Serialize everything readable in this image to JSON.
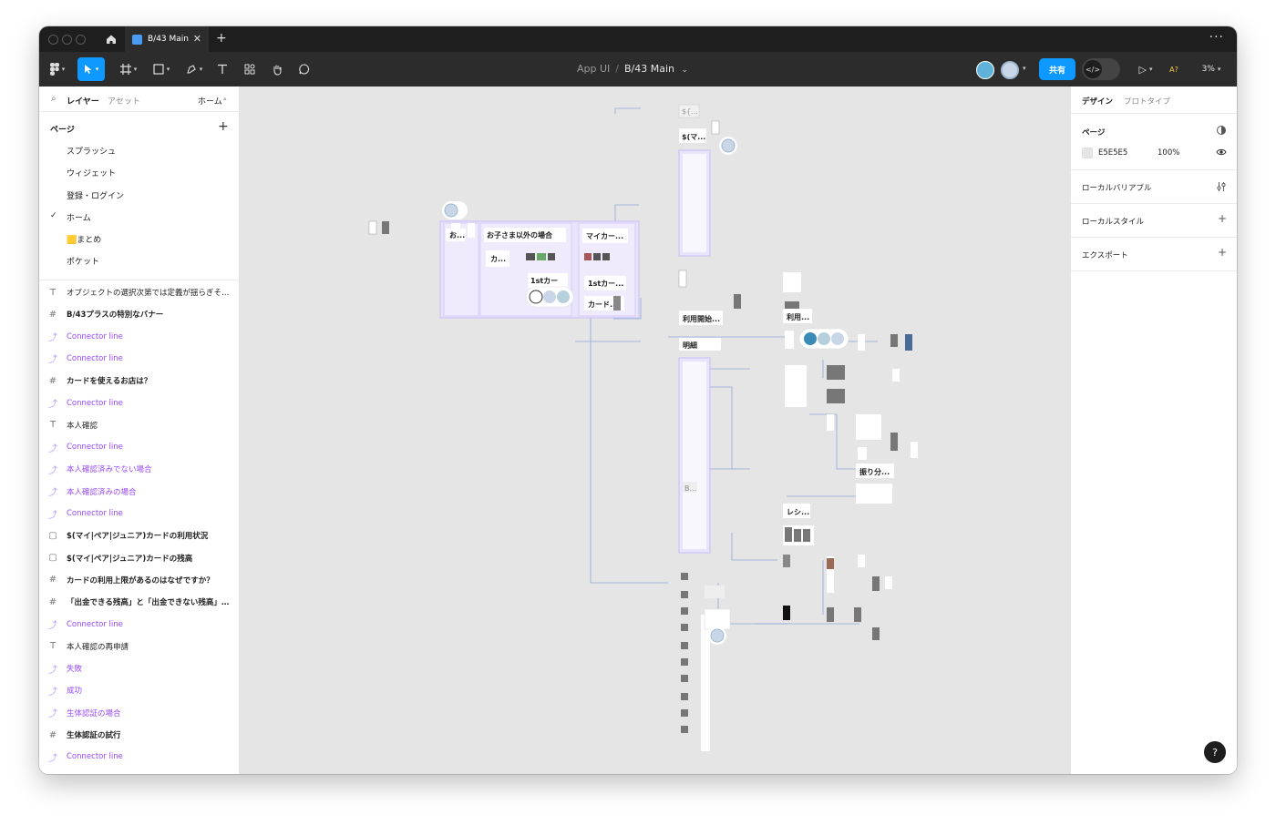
{
  "titlebar": {
    "tab_title": "B/43 Main",
    "close_glyph": "✕",
    "add_glyph": "+",
    "more_glyph": "···"
  },
  "toolbar": {
    "breadcrumb_project": "App UI",
    "breadcrumb_separator": "/",
    "breadcrumb_file": "B/43 Main",
    "breadcrumb_chevron": "⌄",
    "share_label": "共有",
    "dev_mode_glyph": "</>",
    "play_glyph": "▷",
    "ai_badge": "A?",
    "zoom": "3%"
  },
  "left_panel": {
    "tab_layers": "レイヤー",
    "tab_assets": "アセット",
    "current_page_label": "ホーム",
    "pages_heading": "ページ",
    "pages_add": "+",
    "pages": [
      {
        "label": "スプラッシュ",
        "selected": false
      },
      {
        "label": "ウィジェット",
        "selected": false
      },
      {
        "label": "登録・ログイン",
        "selected": false
      },
      {
        "label": "ホーム",
        "selected": true
      },
      {
        "label": "🟨まとめ",
        "selected": false
      },
      {
        "label": "ポケット",
        "selected": false
      }
    ],
    "check_glyph": "✓",
    "layers": [
      {
        "type": "text",
        "label": "オブジェクトの選択次第では定義が揺らぎそう..."
      },
      {
        "type": "frame",
        "label": "B/43プラスの特別なバナー"
      },
      {
        "type": "component",
        "label": "Connector line"
      },
      {
        "type": "component",
        "label": "Connector line"
      },
      {
        "type": "frame",
        "label": "カードを使えるお店は？"
      },
      {
        "type": "component",
        "label": "Connector line"
      },
      {
        "type": "text",
        "label": "本人確認"
      },
      {
        "type": "component",
        "label": "Connector line"
      },
      {
        "type": "component",
        "label": "本人確認済みでない場合"
      },
      {
        "type": "component",
        "label": "本人確認済みの場合"
      },
      {
        "type": "component",
        "label": "Connector line"
      },
      {
        "type": "section",
        "label": "$(マイ|ペア|ジュニア)カードの利用状況"
      },
      {
        "type": "section",
        "label": "$(マイ|ペア|ジュニア)カードの残高"
      },
      {
        "type": "frame",
        "label": "カードの利用上限があるのはなぜですか？"
      },
      {
        "type": "frame",
        "label": "「出金できる残高」と「出金できない残高」の..."
      },
      {
        "type": "component",
        "label": "Connector line"
      },
      {
        "type": "text",
        "label": "本人確認の再申請"
      },
      {
        "type": "component",
        "label": "失敗"
      },
      {
        "type": "component",
        "label": "成功"
      },
      {
        "type": "component",
        "label": "生体認証の場合"
      },
      {
        "type": "frame",
        "label": "生体認証の試行"
      },
      {
        "type": "component",
        "label": "Connector line"
      }
    ]
  },
  "canvas": {
    "labels": {
      "l1": "${...",
      "l2": "$(マ...",
      "l3": "お...",
      "l4": "お子さま以外の場合",
      "l5": "マイカー...",
      "l6": "カ...",
      "l7": "1stカー",
      "l8": "1stカー...",
      "l9": "カード...",
      "l10": "利用開始...",
      "l11": "明細",
      "l12": "利用...",
      "l13": "振り分...",
      "l14": "レシ...",
      "l15": "B..."
    }
  },
  "right_panel": {
    "tab_design": "デザイン",
    "tab_prototype": "プロトタイプ",
    "page_heading": "ページ",
    "page_color": "E5E5E5",
    "page_opacity": "100%",
    "local_variables": "ローカルバリアブル",
    "local_styles": "ローカルスタイル",
    "export": "エクスポート",
    "plus_glyph": "+",
    "help_glyph": "?"
  },
  "colors": {
    "accent": "#0d99ff",
    "component_purple": "#9747ff",
    "canvas_bg": "#e5e5e5",
    "section_fill": "#e8e4fb"
  }
}
